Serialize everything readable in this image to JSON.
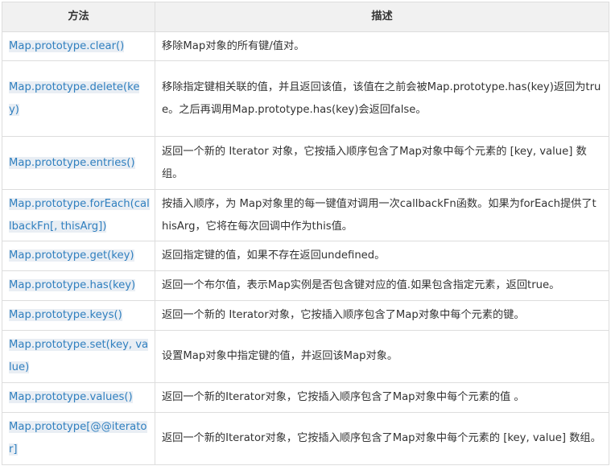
{
  "table": {
    "headers": [
      "方法",
      "描述"
    ],
    "rows": [
      {
        "method": "Map.prototype.clear()",
        "description": "移除Map对象的所有键/值对。"
      },
      {
        "method": "Map.prototype.delete(key)",
        "description": "移除指定键相关联的值，并且返回该值，该值在之前会被Map.prototype.has(key)返回为true。之后再调用Map.prototype.has(key)会返回false。"
      },
      {
        "method": "Map.prototype.entries()",
        "description": "返回一个新的 Iterator 对象，它按插入顺序包含了Map对象中每个元素的 [key, value] 数组。"
      },
      {
        "method": "Map.prototype.forEach(callbackFn[, thisArg])",
        "description": "按插入顺序，为 Map对象里的每一键值对调用一次callbackFn函数。如果为forEach提供了thisArg，它将在每次回调中作为this值。"
      },
      {
        "method": "Map.prototype.get(key)",
        "description": "返回指定键的值，如果不存在返回undefined。"
      },
      {
        "method": "Map.prototype.has(key)",
        "description": "返回一个布尔值，表示Map实例是否包含键对应的值.如果包含指定元素，返回true。"
      },
      {
        "method": "Map.prototype.keys()",
        "description": "返回一个新的 Iterator对象，它按插入顺序包含了Map对象中每个元素的键。"
      },
      {
        "method": "Map.prototype.set(key, value)",
        "description": "设置Map对象中指定键的值，并返回该Map对象。"
      },
      {
        "method": "Map.prototype.values()",
        "description": "返回一个新的Iterator对象，它按插入顺序包含了Map对象中每个元素的值 。"
      },
      {
        "method": "Map.prototype[@@iterator]",
        "description": "返回一个新的Iterator对象，它按插入顺序包含了Map对象中每个元素的 [key, value] 数组。"
      }
    ]
  }
}
